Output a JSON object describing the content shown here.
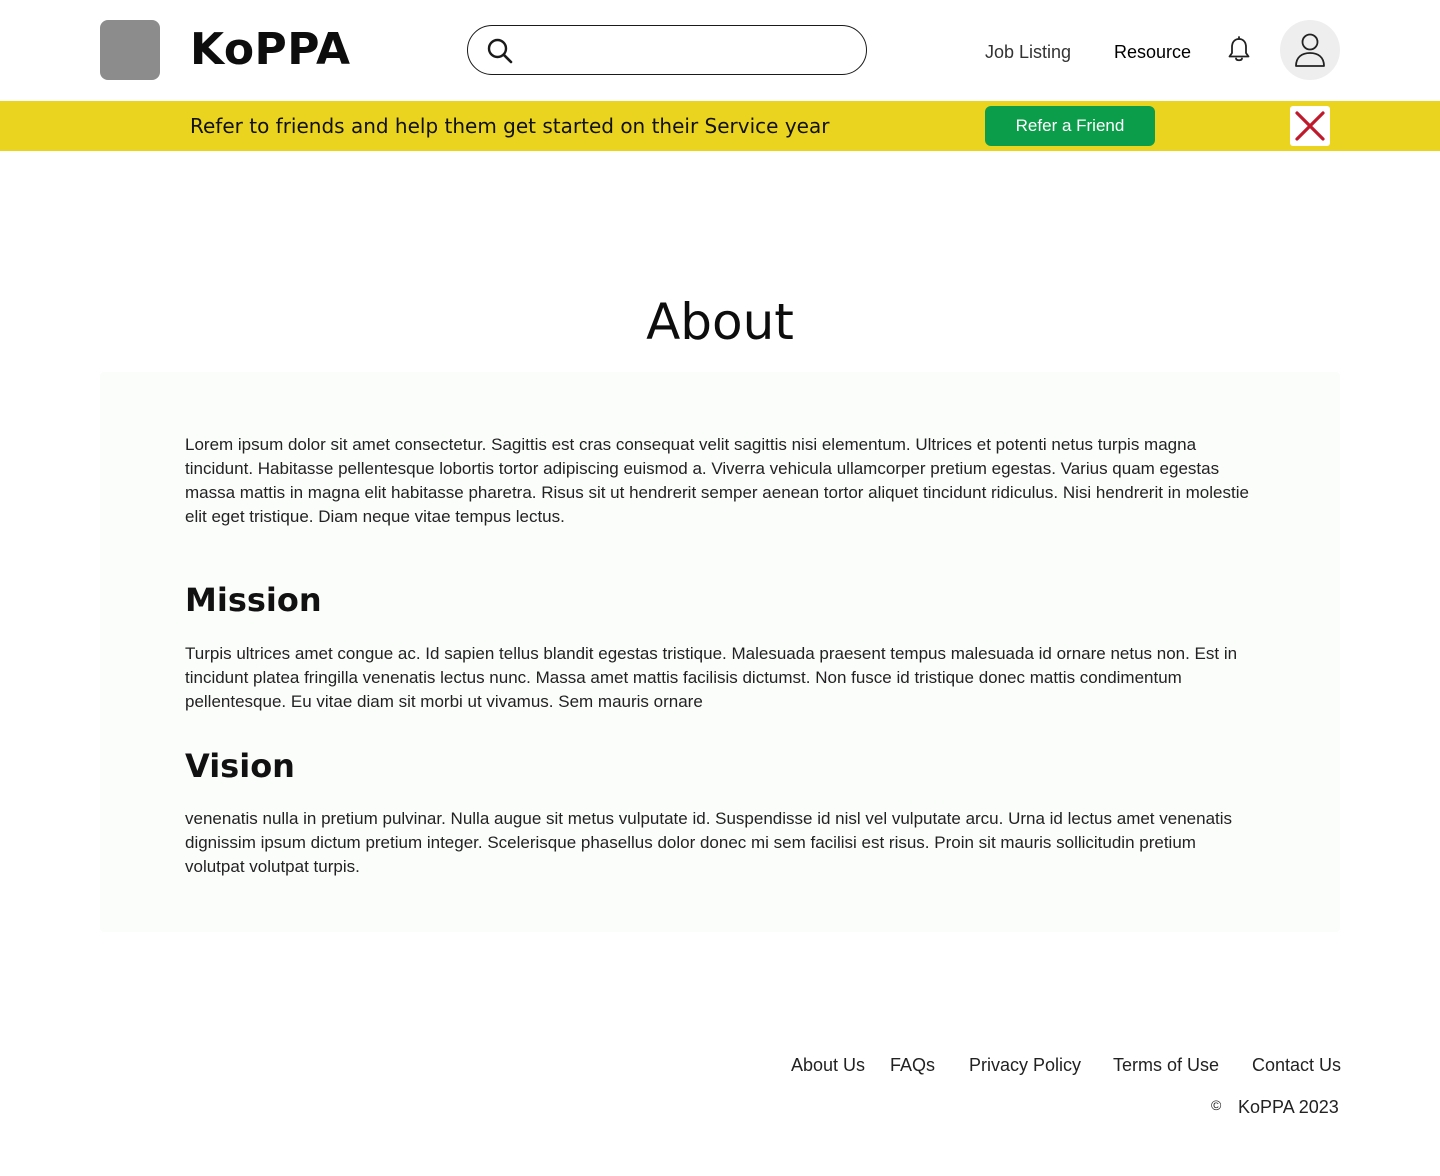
{
  "header": {
    "brand": "KoPPA",
    "search": {
      "placeholder": "",
      "value": ""
    },
    "nav": {
      "job_listing": "Job Listing",
      "resource": "Resource"
    },
    "icons": {
      "search": "search-icon",
      "bell": "bell-icon",
      "user": "user-icon"
    }
  },
  "banner": {
    "text": "Refer to friends and help them get started on their Service year",
    "button_label": "Refer a Friend",
    "close_icon": "close-icon",
    "colors": {
      "background": "#ebd41f",
      "button": "#0b9d4a",
      "close": "#c0192c"
    }
  },
  "main": {
    "title": "About",
    "intro": "Lorem ipsum dolor sit amet consectetur. Sagittis est cras consequat velit sagittis nisi elementum. Ultrices et potenti netus turpis magna tincidunt. Habitasse pellentesque lobortis tortor adipiscing euismod a. Viverra vehicula ullamcorper pretium egestas. Varius quam egestas massa mattis in magna elit habitasse pharetra. Risus sit ut hendrerit semper aenean tortor aliquet tincidunt ridiculus. Nisi hendrerit in molestie elit eget tristique. Diam neque vitae tempus lectus.",
    "mission": {
      "title": "Mission",
      "text": "Turpis ultrices amet congue ac. Id sapien tellus blandit egestas tristique. Malesuada praesent tempus malesuada id ornare netus non. Est in tincidunt platea fringilla venenatis lectus nunc. Massa amet mattis facilisis dictumst. Non fusce id tristique donec mattis condimentum pellentesque. Eu vitae diam sit morbi ut vivamus. Sem mauris ornare"
    },
    "vision": {
      "title": "Vision",
      "text": "venenatis nulla in pretium pulvinar. Nulla augue sit metus vulputate id. Suspendisse id nisl vel vulputate arcu. Urna id lectus amet venenatis dignissim ipsum dictum pretium integer. Scelerisque phasellus dolor donec mi sem facilisi est risus. Proin sit mauris sollicitudin pretium volutpat volutpat turpis."
    }
  },
  "footer": {
    "links": {
      "about": "About Us",
      "faqs": "FAQs",
      "privacy": "Privacy Policy",
      "terms": "Terms of Use",
      "contact": "Contact Us"
    },
    "copyright_symbol": "©",
    "copyright": "KoPPA 2023"
  }
}
